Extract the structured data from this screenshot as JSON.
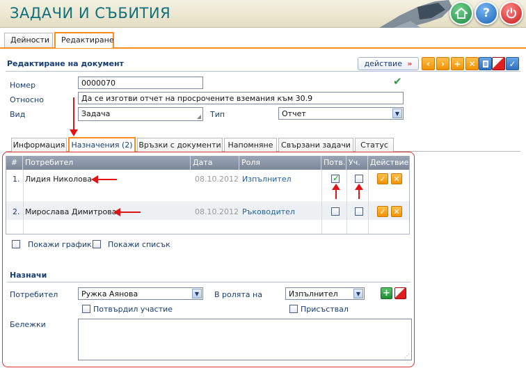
{
  "header": {
    "title": "ЗАДАЧИ И СЪБИТИЯ"
  },
  "top_tabs": [
    "Дейности",
    "Редактиране"
  ],
  "section": {
    "title": "Редактиране на документ",
    "action_label": "действие"
  },
  "toolbar_icons": [
    "prev-icon",
    "next-icon",
    "add-icon",
    "delete-icon",
    "print-icon",
    "clear-icon",
    "confirm-icon"
  ],
  "form": {
    "number_label": "Номер",
    "number_value": "0000070",
    "subject_label": "Относно",
    "subject_value": "Да се изготви отчет на просрочените вземания към 30.9",
    "kind_label": "Вид",
    "kind_value": "Задача",
    "type_label": "Тип",
    "type_value": "Отчет"
  },
  "inner_tabs": [
    "Информация",
    "Назначения (2)",
    "Връзки с документи",
    "Напомняне",
    "Свързани задачи",
    "Статус"
  ],
  "table": {
    "columns": [
      "#",
      "Потребител",
      "Дата",
      "Роля",
      "Потв.",
      "Уч.",
      "Действие"
    ],
    "rows": [
      {
        "num": "1.",
        "user": "Лидия Николова",
        "date": "08.10.2012",
        "role": "Изпълнител",
        "confirmed": true,
        "participated": false
      },
      {
        "num": "2.",
        "user": "Мирослава Димитрова",
        "date": "08.10.2012",
        "role": "Ръководител",
        "confirmed": false,
        "participated": false
      }
    ]
  },
  "options": {
    "show_chart": "Покажи график",
    "show_list": "Покажи списък"
  },
  "assign": {
    "title": "Назначи",
    "user_label": "Потребител",
    "user_value": "Ружка Аянова",
    "role_label": "В ролята на",
    "role_value": "Изпълнител",
    "confirmed_label": "Потвърдил участие",
    "present_label": "Присъствал",
    "notes_label": "Бележки",
    "notes_value": ""
  },
  "colors": {
    "accent": "#ff8c1a",
    "brand": "#0f6f7d",
    "annotation": "#e01414"
  }
}
